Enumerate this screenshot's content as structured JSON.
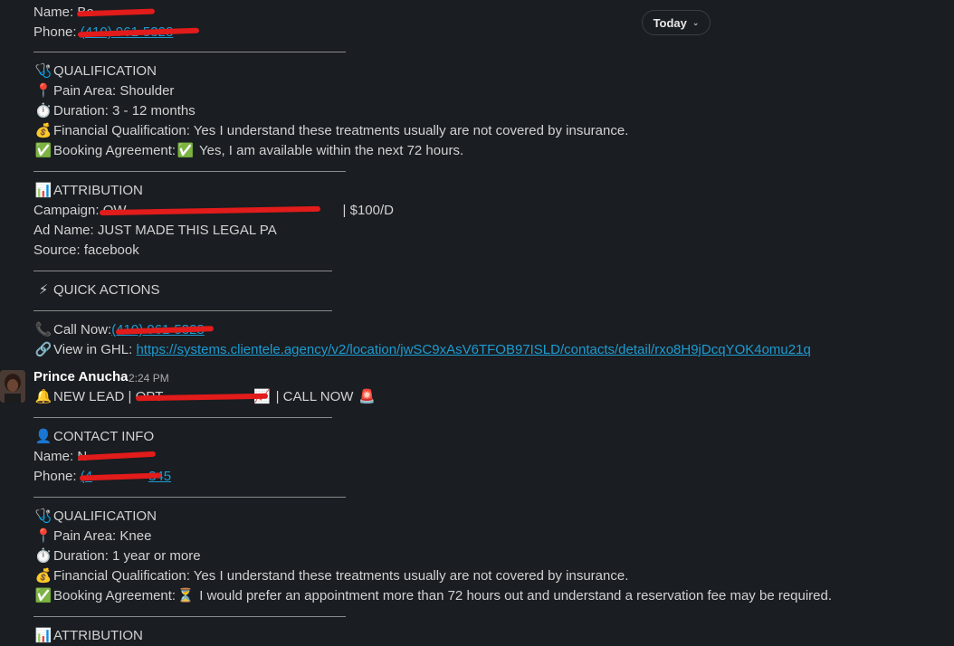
{
  "date_divider": {
    "label": "Today"
  },
  "message1": {
    "name_line": "Name: Be",
    "phone_label": "Phone:",
    "phone_visible": "(410) 961-5328",
    "qualification_header": "QUALIFICATION",
    "pain_area": "Pain Area: Shoulder",
    "duration": "Duration: 3 - 12 months",
    "financial": "Financial Qualification: Yes I understand these treatments usually are not covered by insurance.",
    "booking_label": "Booking Agreement:",
    "booking_value": " Yes, I am available within the next 72 hours.",
    "attribution_header": "ATTRIBUTION",
    "campaign_label": "Campaign: OW",
    "campaign_suffix": "| $100/D",
    "ad_name": "Ad Name: JUST MADE THIS LEGAL PA",
    "source": "Source: facebook",
    "quick_actions_header": "QUICK ACTIONS",
    "call_now_label": "Call Now:",
    "call_now_number": "(410) 961-5328",
    "view_ghl_label": "View in GHL:",
    "view_ghl_url": "https://systems.clientele.agency/v2/location/jwSC9xAsV6TFOB97ISLD/contacts/detail/rxo8H9jDcqYOK4omu21q"
  },
  "message2": {
    "sender": "Prince Anucha",
    "time": "2:24 PM",
    "new_lead_prefix": "NEW LEAD | OPT",
    "new_lead_tail": "| CALL NOW",
    "contact_header": "CONTACT INFO",
    "name_label": "Name: N",
    "phone_label": "Phone:",
    "phone_visible": "(4",
    "phone_tail": "345",
    "qualification_header": "QUALIFICATION",
    "pain_area": "Pain Area: Knee",
    "duration": "Duration: 1 year or more",
    "financial": "Financial Qualification: Yes I understand these treatments usually are not covered by insurance.",
    "booking_label": "Booking Agreement:",
    "booking_value": " I would prefer an appointment more than 72 hours out and understand a reservation fee may be required.",
    "attribution_header": "ATTRIBUTION"
  }
}
